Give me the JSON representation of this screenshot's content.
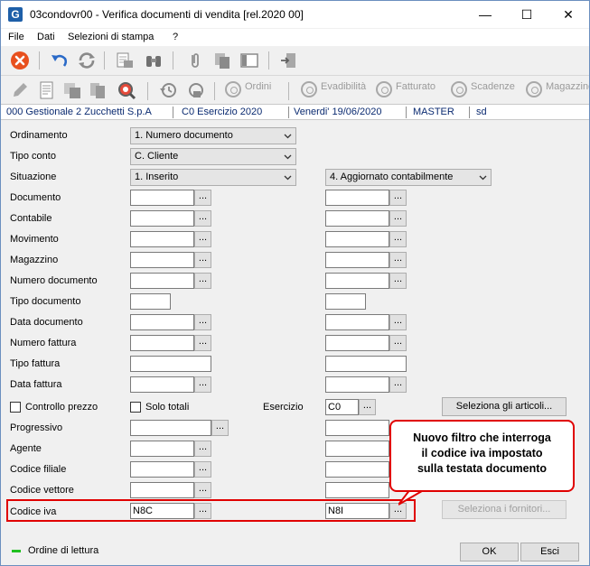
{
  "window": {
    "title": "03condovr00 - Verifica documenti di vendita  [rel.2020 00]",
    "app_icon_letter": "G",
    "minimize_glyph": "—",
    "maximize_glyph": "☐",
    "close_glyph": "✕"
  },
  "menu": [
    "File",
    "Dati",
    "Selezioni di stampa",
    "?"
  ],
  "toolbar2": {
    "buttons": [
      "Ordini",
      "Evadibilità",
      "Fatturato",
      "Scadenze",
      "Magazzino"
    ]
  },
  "status": {
    "company": "000 Gestionale 2 Zucchetti S.p.A",
    "exercise": "C0 Esercizio 2020",
    "date": "Venerdi' 19/06/2020",
    "user": "MASTER",
    "extra": "sd"
  },
  "form": {
    "ordinamento": {
      "label": "Ordinamento",
      "value": "1. Numero documento"
    },
    "tipo_conto": {
      "label": "Tipo conto",
      "value": "C. Cliente"
    },
    "situazione": {
      "label": "Situazione",
      "value_from": "1. Inserito",
      "value_to": "4. Aggiornato contabilmente"
    },
    "rows": [
      {
        "label": "Documento"
      },
      {
        "label": "Contabile"
      },
      {
        "label": "Movimento"
      },
      {
        "label": "Magazzino"
      },
      {
        "label": "Numero documento"
      },
      {
        "label": "Tipo documento"
      },
      {
        "label": "Data documento"
      },
      {
        "label": "Numero fattura"
      },
      {
        "label": "Tipo fattura"
      },
      {
        "label": "Data fattura"
      }
    ],
    "controllo_prezzo": "Controllo prezzo",
    "solo_totali": "Solo totali",
    "esercizio": {
      "label": "Esercizio",
      "value": "C0"
    },
    "seleziona_articoli": "Seleziona gli articoli...",
    "progressivo": "Progressivo",
    "agente": "Agente",
    "codice_filiale": "Codice filiale",
    "codice_vettore": "Codice vettore",
    "codice_iva": {
      "label": "Codice iva",
      "value_from": "N8C",
      "value_to": "N8I"
    },
    "seleziona_fornitori": "Seleziona i fornitori...",
    "dots": "..."
  },
  "callout": {
    "lines": [
      "Nuovo filtro che interroga",
      "il codice iva impostato",
      "sulla testata documento"
    ]
  },
  "footer": {
    "legend": "Ordine di lettura",
    "ok": "OK",
    "esci": "Esci"
  },
  "colors": {
    "status_text": "#0a2a70",
    "highlight_red": "#e00000",
    "legend_green": "#20c020"
  }
}
